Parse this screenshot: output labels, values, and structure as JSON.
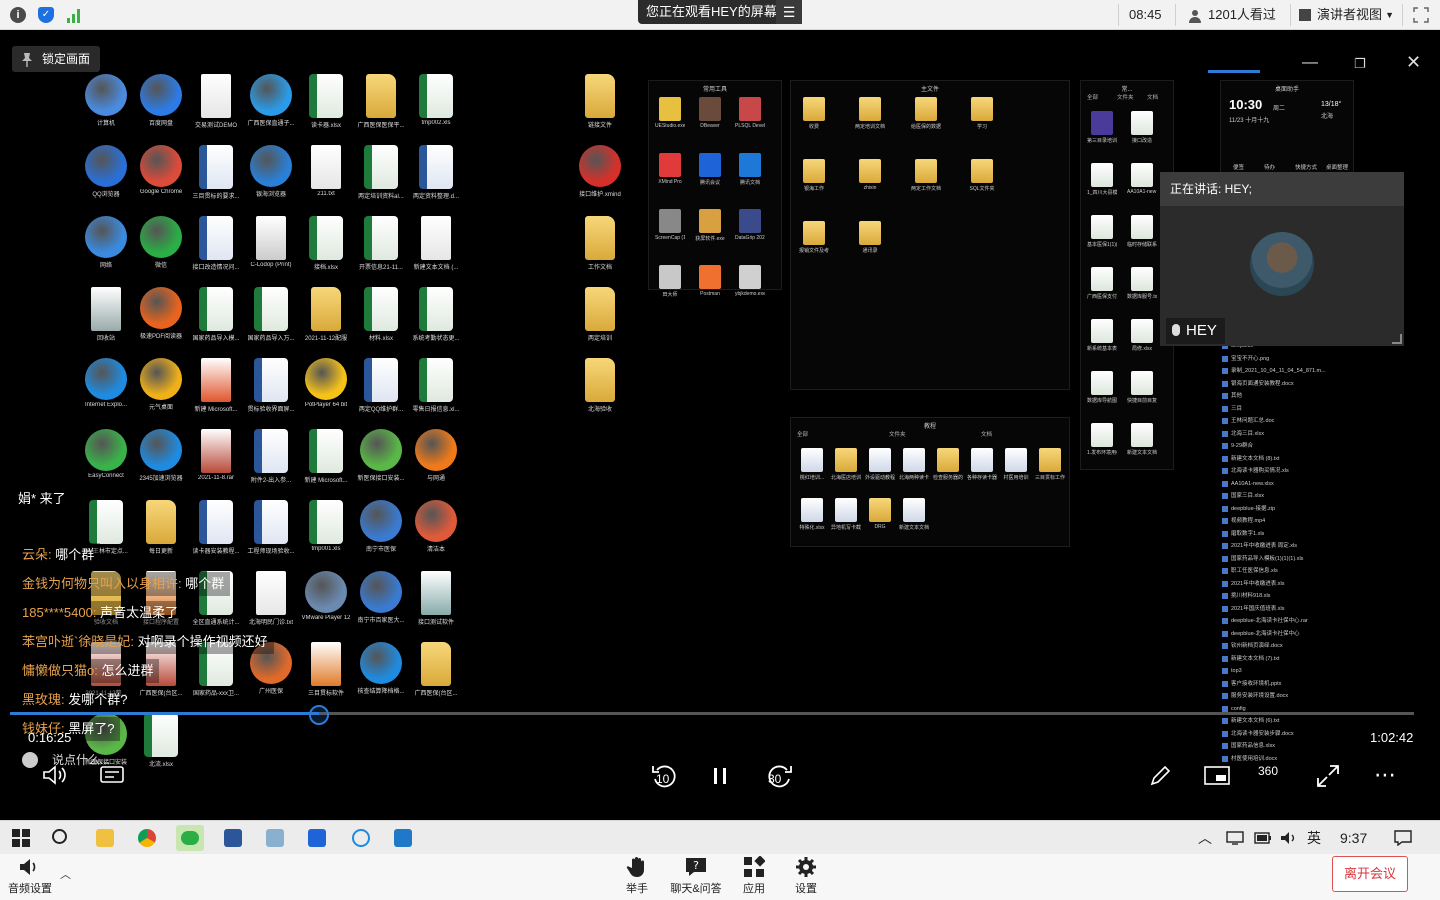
{
  "topbar": {
    "viewing_text": "您正在观看HEY的屏幕",
    "clock": "08:45",
    "viewers": "1201人看过",
    "view_mode": "演讲者视图"
  },
  "stage": {
    "lock_label": "锁定画面",
    "speaking_label": "正在讲话: HEY;",
    "speaker_name": "HEY",
    "time_current": "0:16:25",
    "time_total": "1:02:42",
    "progress_fraction": 0.22,
    "comment_placeholder": "说点什么..."
  },
  "desktop": {
    "icons": [
      {
        "label": "计算机",
        "kind": "round",
        "color": "#4a8be0"
      },
      {
        "label": "百度网盘",
        "kind": "round",
        "color": "#2d7be6"
      },
      {
        "label": "交易测试DEMO",
        "kind": "doc",
        "color": "#fff"
      },
      {
        "label": "广西医保直通子...",
        "kind": "round",
        "color": "#2a9be8"
      },
      {
        "label": "读卡器.xlsx",
        "kind": "xls",
        "color": "#1e7b3c"
      },
      {
        "label": "广西医保医保平...",
        "kind": "folder",
        "color": "#e0b64a"
      },
      {
        "label": "tmp002.xls",
        "kind": "xls",
        "color": "#1e7b3c"
      },
      {
        "label": "QQ浏览器",
        "kind": "round",
        "color": "#2a6fd6"
      },
      {
        "label": "Google Chrome",
        "kind": "round",
        "color": "#dd4b39"
      },
      {
        "label": "三目贯标的要求...",
        "kind": "word",
        "color": "#2b579a"
      },
      {
        "label": "银海浏览器",
        "kind": "round",
        "color": "#2a7fd6"
      },
      {
        "label": "211.txt",
        "kind": "doc",
        "color": "#fff"
      },
      {
        "label": "两定培训资料al...",
        "kind": "xls",
        "color": "#1e7b3c"
      },
      {
        "label": "两定资料整理.d...",
        "kind": "word",
        "color": "#2b579a"
      },
      {
        "label": "网络",
        "kind": "round",
        "color": "#3a8be0"
      },
      {
        "label": "微信",
        "kind": "round",
        "color": "#2aae45"
      },
      {
        "label": "接口改造情况问...",
        "kind": "word",
        "color": "#2b579a"
      },
      {
        "label": "C-Lodop (Print)",
        "kind": "doc",
        "color": "#ccc"
      },
      {
        "label": "接档.xlsx",
        "kind": "xls",
        "color": "#1e7b3c"
      },
      {
        "label": "开票信息21-11...",
        "kind": "xls",
        "color": "#1e7b3c"
      },
      {
        "label": "新建文本文档 (...",
        "kind": "doc",
        "color": "#fff"
      },
      {
        "label": "回收站",
        "kind": "doc",
        "color": "#9aa"
      },
      {
        "label": "极速PDF阅读器",
        "kind": "round",
        "color": "#e8641e"
      },
      {
        "label": "国家药品导入模...",
        "kind": "xls",
        "color": "#1e7b3c"
      },
      {
        "label": "国家药品导入万...",
        "kind": "xls",
        "color": "#1e7b3c"
      },
      {
        "label": "2021-11-12配服",
        "kind": "folder",
        "color": "#e0b64a"
      },
      {
        "label": "材料.xlsx",
        "kind": "xls",
        "color": "#1e7b3c"
      },
      {
        "label": "系统考勤状态更...",
        "kind": "xls",
        "color": "#1e7b3c"
      },
      {
        "label": "Internet Explo...",
        "kind": "round",
        "color": "#1f8be0"
      },
      {
        "label": "元气桌面",
        "kind": "round",
        "color": "#f0b01a"
      },
      {
        "label": "新建 Microsoft...",
        "kind": "doc",
        "color": "#e0562e"
      },
      {
        "label": "贯标验收界面屏...",
        "kind": "word",
        "color": "#2b579a"
      },
      {
        "label": "PotPlayer 64 bit",
        "kind": "round",
        "color": "#f5c21a"
      },
      {
        "label": "两定QQ维护群...",
        "kind": "word",
        "color": "#2b579a"
      },
      {
        "label": "零售日报信息.xl...",
        "kind": "xls",
        "color": "#1e7b3c"
      },
      {
        "label": "EasyConnect",
        "kind": "round",
        "color": "#3ab24a"
      },
      {
        "label": "2345加速浏览器",
        "kind": "round",
        "color": "#1f8be0"
      },
      {
        "label": "2021-11-8.rar",
        "kind": "doc",
        "color": "#b84a3a"
      },
      {
        "label": "附件2-出入参...",
        "kind": "word",
        "color": "#2b579a"
      },
      {
        "label": "新建 Microsoft...",
        "kind": "xls",
        "color": "#1e7b3c"
      },
      {
        "label": "新医保接口安装...",
        "kind": "round",
        "color": "#5ab848"
      },
      {
        "label": "与网通",
        "kind": "round",
        "color": "#f07a1a"
      },
      {
        "label": "04-王林市定点...",
        "kind": "xls",
        "color": "#1e7b3c"
      },
      {
        "label": "每日更新",
        "kind": "folder",
        "color": "#e0b64a"
      },
      {
        "label": "读卡器安装教程...",
        "kind": "word",
        "color": "#2b579a"
      },
      {
        "label": "工程师现场验收...",
        "kind": "word",
        "color": "#2b579a"
      },
      {
        "label": "tmp001.xls",
        "kind": "xls",
        "color": "#1e7b3c"
      },
      {
        "label": "南宁市医保",
        "kind": "round",
        "color": "#3a7ad0"
      },
      {
        "label": "清洁本",
        "kind": "round",
        "color": "#e05a3a"
      },
      {
        "label": "验收文档",
        "kind": "folder",
        "color": "#e0b64a"
      },
      {
        "label": "接口程序配置",
        "kind": "doc",
        "color": "#e07a2a"
      },
      {
        "label": "全区直通系统计...",
        "kind": "xls",
        "color": "#1e7b3c"
      },
      {
        "label": "北海明民门诊.txt",
        "kind": "doc",
        "color": "#fff"
      },
      {
        "label": "VMware Player 12",
        "kind": "round",
        "color": "#6a8ab0"
      },
      {
        "label": "南宁市百家医大...",
        "kind": "round",
        "color": "#3a7ad0"
      },
      {
        "label": "接口测试软件",
        "kind": "doc",
        "color": "#8aa"
      },
      {
        "label": "2021-11-12整...",
        "kind": "doc",
        "color": "#b84a3a"
      },
      {
        "label": "广西医保(台区...",
        "kind": "doc",
        "color": "#b84a3a"
      },
      {
        "label": "国家药品-xxx卫...",
        "kind": "xls",
        "color": "#1e7b3c"
      },
      {
        "label": "广州医保",
        "kind": "round",
        "color": "#e06a2a"
      },
      {
        "label": "三目贯标软件",
        "kind": "doc",
        "color": "#e07a2a"
      },
      {
        "label": "核查结算降档格...",
        "kind": "round",
        "color": "#1f8be0"
      },
      {
        "label": "广西医保(台区...",
        "kind": "folder",
        "color": "#e0b64a"
      },
      {
        "label": "新医保接口安装",
        "kind": "round",
        "color": "#5ab848"
      },
      {
        "label": "北流.xlsx",
        "kind": "xls",
        "color": "#1e7b3c"
      }
    ],
    "column_folders": [
      {
        "label": "链接文件"
      },
      {
        "label": "接口维护.xmind"
      },
      {
        "label": "工作文档"
      },
      {
        "label": "两定培训"
      },
      {
        "label": "北海验收"
      }
    ],
    "tools_window": {
      "title": "常用工具",
      "items": [
        "UEStudio.exe",
        "DBeaver",
        "PLSQL Developer",
        "XMind Pro",
        "腾讯会议",
        "腾讯文档",
        "ScreenCap (1).exe",
        "获屏软件.exe",
        "DataGrip 2021.2.2",
        "田大师",
        "Postman",
        "ybjkdemo.exe"
      ]
    },
    "main_window": {
      "title": "主文件",
      "items": [
        "收费",
        "两定培训文档-S...",
        "给医保的数据",
        "学习",
        "银海工作",
        "zhixin",
        "两定工作文档",
        "SQL文件夹",
        "报销文件及考勤",
        "通讯录"
      ]
    },
    "files_window": {
      "title": "常...",
      "tabs": [
        "全部",
        "文件夹",
        "文档"
      ],
      "items": [
        "第三目录培训.mp4",
        "接口改造",
        "1_四川大县模板软件...",
        "AA10A1-new (1).xl...",
        "基本医保1(1)(1)(1).x...",
        "临时存储联系方式.txt",
        "广西医保支付接口规...",
        "数据库服号.txt",
        "新系统基本表格.xlsx",
        "局修.xlsx",
        "数据库导航图.png",
        "快捷目前目复.xls",
        "1.发布环境用纪实.xls...",
        "新建文本文档 (9).txt"
      ]
    },
    "tutorial_window": {
      "title": "教程",
      "tabs": [
        "全部",
        "文件夹",
        "文档"
      ],
      "items": [
        "桃红培训...",
        "北海医店培训",
        "外设驱动教程（参考...",
        "北海两种读卡器",
        "检查服务器的步骤.do...",
        "各种存读卡器汇总.xlsx",
        "村医用培训",
        "三目贯标工作",
        "特殊化.xlsx",
        "异地机写卡截教程.do...",
        "DRG",
        "新建文本文档 (10).txt"
      ]
    },
    "widget": {
      "title": "桌面助手",
      "clock": "10:30",
      "weekday": "周二",
      "date": "11/23 十月十九",
      "temp": "13/18°",
      "city": "北海",
      "actions": [
        "便签",
        "待办",
        "快捷方式",
        "桌面整理"
      ]
    },
    "filelist": [
      "deepblue",
      "宝宝不开心.png",
      "录制_2021_10_04_11_04_54_871.m...",
      "银海页面通安装教程.docx",
      "其他",
      "三目",
      "王林问题汇总.doc",
      "北海三目.xlsx",
      "9-29群合",
      "新建文本文档 (8).txt",
      "北海读卡器购买情况.xls",
      "AA10A1-new.xlsx",
      "国家三目.xlsx",
      "deepblue-接据.zip",
      "视频教程.mp4",
      "磨取数字1.xls",
      "2021年中收缴进表 周定.xls",
      "国家药品导入模板(1)(1)(1).xls",
      "职工任医保信息.xls",
      "2021年中收缴进表.xls",
      "挑川材料918.xls",
      "2021年国庆值班表.xls",
      "deepblue-北海读卡社保中心.rar",
      "deepblue-北海读卡社保中心",
      "钦州新档页演绎.docx",
      "新建文本文档 (7).txt",
      "top3",
      "客户接收环境机.pptx",
      "服务安装环境设置.docx",
      "config",
      "新建文本文档 (6).txt",
      "北海读卡器安装步骤.docx",
      "国家药品信息.xlsx",
      "村医使用培训.docx"
    ]
  },
  "chat": [
    {
      "name": "",
      "text": "娟* 来了",
      "plain": true
    },
    {
      "name": "云朵:",
      "text": " 哪个群"
    },
    {
      "name": "金钱为何物只叫入以身相许:",
      "text": " 哪个群"
    },
    {
      "name": "185****5400:",
      "text": " 声音太温柔了"
    },
    {
      "name": "苯宫卟逝`徐晓是妃:",
      "text": " 对啊录个操作视频还好"
    },
    {
      "name": "慵懒做只猫o:",
      "text": " 怎么进群"
    },
    {
      "name": "黑玫瑰:",
      "text": " 发哪个群?"
    },
    {
      "name": "钱妹仔:",
      "text": " 黑屏了?"
    }
  ],
  "player": {
    "rewind_label": "10",
    "forward_label": "30",
    "vr_label": "360"
  },
  "taskbar": {
    "ime": "英",
    "clock": "9:37"
  },
  "bottombar": {
    "audio": "音频设置",
    "raise_hand": "举手",
    "chat": "聊天&问答",
    "apps": "应用",
    "settings": "设置",
    "leave": "离开会议"
  },
  "colors": {
    "accent": "#2e7bd6",
    "chat_name": "#e8a24a",
    "leave": "#d9363e"
  }
}
